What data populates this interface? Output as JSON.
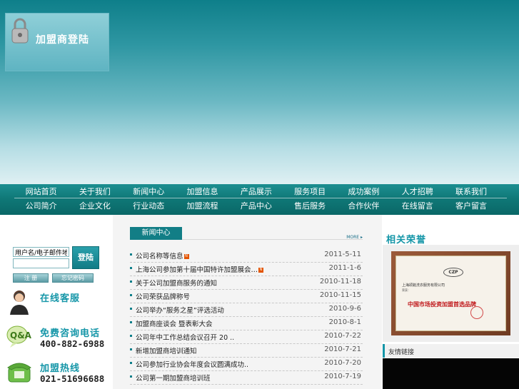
{
  "nav": {
    "row1": [
      "网站首页",
      "关于我们",
      "新闻中心",
      "加盟信息",
      "产品展示",
      "服务项目",
      "成功案例",
      "人才招聘",
      "联系我们"
    ],
    "row2": [
      "公司简介",
      "企业文化",
      "行业动态",
      "加盟流程",
      "产品中心",
      "售后服务",
      "合作伙伴",
      "在线留言",
      "客户留言"
    ]
  },
  "login": {
    "title": "加盟商登陆",
    "username_value": "用户名/电子邮件地",
    "password_value": "",
    "login_label": "登陆",
    "register_label": "注 册",
    "forgot_label": "忘记密码"
  },
  "service": {
    "online_label": "在线客服",
    "consult_label": "免费咨询电话",
    "consult_phone": "400-882-6988",
    "hotline_label": "加盟热线",
    "hotline_phone": "021-51696688"
  },
  "news": {
    "tab_label": "新闻中心",
    "more_label": "MORE ▸",
    "new_badge": "N",
    "items": [
      {
        "title": "公司名称等信息",
        "date": "2011-5-11",
        "new": true
      },
      {
        "title": "上海公司参加第十届中国特许加盟展会…",
        "date": "2011-1-6",
        "new": true
      },
      {
        "title": "关于公司加盟商服务的通知",
        "date": "2010-11-18",
        "new": false
      },
      {
        "title": "公司荣获品牌称号",
        "date": "2010-11-15",
        "new": false
      },
      {
        "title": "公司举办“服务之星”评选活动",
        "date": "2010-9-6",
        "new": false
      },
      {
        "title": "加盟商座谈会 暨表彰大会",
        "date": "2010-8-1",
        "new": false
      },
      {
        "title": "公司年中工作总结会议召开 20 ..",
        "date": "2010-7-22",
        "new": false
      },
      {
        "title": "新增加盟商培训通知",
        "date": "2010-7-21",
        "new": false
      },
      {
        "title": "公司参加行业协会年度会议圆满成功..",
        "date": "2010-7-20",
        "new": false
      },
      {
        "title": "公司第一期加盟商培训班",
        "date": "2010-7-19",
        "new": false
      }
    ]
  },
  "honor": {
    "title": "相关荣誉",
    "cert_logo": "CZP",
    "cert_company": "上海颂銘洗衣服务有限公司",
    "cert_line": "荣获：",
    "cert_award": "中国市场投资加盟首选品牌"
  },
  "links": {
    "title": "友情链接"
  },
  "colors": {
    "teal": "#127e86",
    "accent": "#1596a8"
  }
}
